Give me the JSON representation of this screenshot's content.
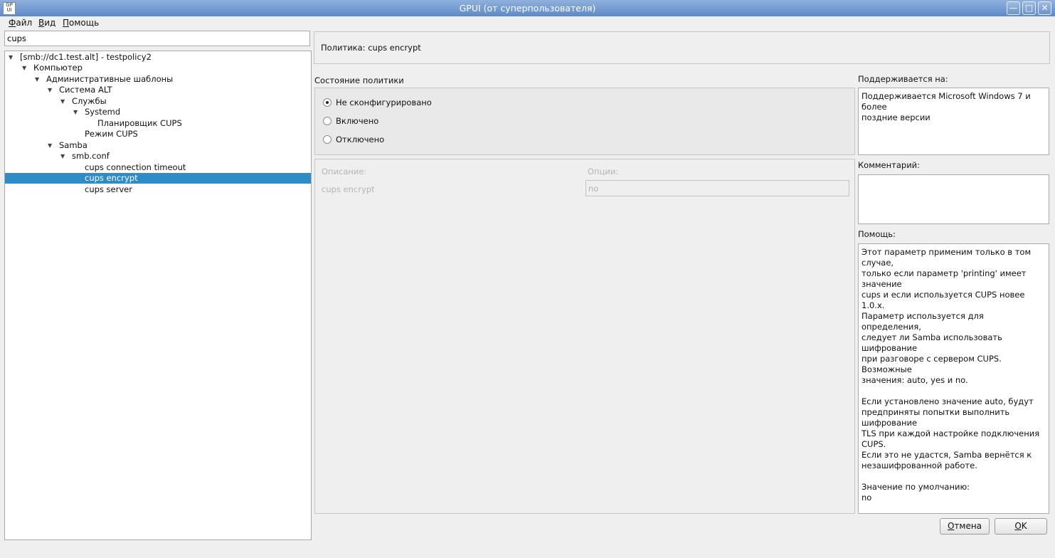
{
  "window": {
    "title": "GPUI (от суперпользователя)",
    "app_icon_text": "GP UI"
  },
  "menu": [
    "Файл",
    "Вид",
    "Помощь"
  ],
  "search": {
    "value": "cups"
  },
  "tree": [
    {
      "label": "[smb://dc1.test.alt] - testpolicy2",
      "depth": 0,
      "expanded": true
    },
    {
      "label": "Компьютер",
      "depth": 1,
      "expanded": true
    },
    {
      "label": "Административные шаблоны",
      "depth": 2,
      "expanded": true
    },
    {
      "label": "Система ALT",
      "depth": 3,
      "expanded": true
    },
    {
      "label": "Службы",
      "depth": 4,
      "expanded": true
    },
    {
      "label": "Systemd",
      "depth": 5,
      "expanded": true
    },
    {
      "label": "Планировщик CUPS",
      "depth": 7,
      "expanded": null
    },
    {
      "label": "Режим CUPS",
      "depth": 6,
      "expanded": null
    },
    {
      "label": "Samba",
      "depth": 3,
      "expanded": true
    },
    {
      "label": "smb.conf",
      "depth": 4,
      "expanded": true
    },
    {
      "label": "cups connection timeout",
      "depth": 6,
      "expanded": null
    },
    {
      "label": "cups encrypt",
      "depth": 6,
      "expanded": null,
      "selected": true
    },
    {
      "label": "cups server",
      "depth": 6,
      "expanded": null
    }
  ],
  "policy": {
    "header": "Политика: cups encrypt",
    "state_label": "Состояние политики",
    "states": [
      {
        "label": "Не сконфигурировано",
        "checked": true
      },
      {
        "label": "Включено",
        "checked": false
      },
      {
        "label": "Отключено",
        "checked": false
      }
    ],
    "description_label": "Описание:",
    "options_label": "Опции:",
    "option_name": "cups encrypt",
    "option_value": "no"
  },
  "supported": {
    "label": "Поддерживается на:",
    "text": "Поддерживается Microsoft Windows 7 и более\nпоздние версии"
  },
  "comment": {
    "label": "Комментарий:",
    "value": ""
  },
  "help": {
    "label": "Помощь:",
    "text": "Этот параметр применим только в том случае,\nтолько если параметр 'printing' имеет значение\ncups и если используется CUPS новее 1.0.x.\nПараметр используется для определения,\nследует ли Samba использовать шифрование\nпри разговоре с сервером CUPS. Возможные\nзначения: auto, yes и no.\n\nЕсли установлено значение auto, будут\nпредприняты попытки выполнить шифрование\nTLS при каждой настройке подключения CUPS.\nЕсли это не удастся, Samba вернётся к\nнезашифрованной работе.\n\nЗначение по умолчанию:\nno"
  },
  "buttons": {
    "cancel": "Отмена",
    "ok": "OK"
  }
}
